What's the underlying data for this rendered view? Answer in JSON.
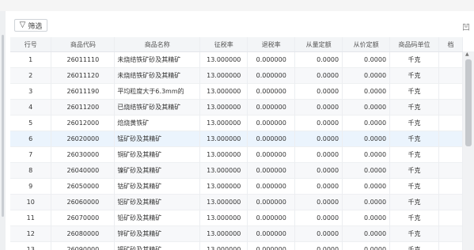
{
  "toolbar": {
    "filter_icon": "filter-icon",
    "filter_label": "筛选",
    "corner_label": "凹"
  },
  "table": {
    "columns": [
      "行号",
      "商品代码",
      "商品名称",
      "征税率",
      "退税率",
      "从量定额",
      "从价定额",
      "商品码单位",
      "档"
    ],
    "rows": [
      [
        "1",
        "26011110",
        "未烧结铁矿砂及其精矿",
        "13.000000",
        "0.000000",
        "0.0000",
        "0.0000",
        "千克"
      ],
      [
        "2",
        "26011120",
        "未烧结铁矿砂及其精矿",
        "13.000000",
        "0.000000",
        "0.0000",
        "0.0000",
        "千克"
      ],
      [
        "3",
        "26011190",
        "平均粒度大于6.3mm的",
        "13.000000",
        "0.000000",
        "0.0000",
        "0.0000",
        "千克"
      ],
      [
        "4",
        "26011200",
        "已烧结铁矿砂及其精矿",
        "13.000000",
        "0.000000",
        "0.0000",
        "0.0000",
        "千克"
      ],
      [
        "5",
        "26012000",
        "焙烧黄铁矿",
        "13.000000",
        "0.000000",
        "0.0000",
        "0.0000",
        "千克"
      ],
      [
        "6",
        "26020000",
        "锰矿砂及其精矿",
        "13.000000",
        "0.000000",
        "0.0000",
        "0.0000",
        "千克"
      ],
      [
        "7",
        "26030000",
        "铜矿砂及其精矿",
        "13.000000",
        "0.000000",
        "0.0000",
        "0.0000",
        "千克"
      ],
      [
        "8",
        "26040000",
        "镍矿砂及其精矿",
        "13.000000",
        "0.000000",
        "0.0000",
        "0.0000",
        "千克"
      ],
      [
        "9",
        "26050000",
        "钴矿砂及其精矿",
        "13.000000",
        "0.000000",
        "0.0000",
        "0.0000",
        "千克"
      ],
      [
        "10",
        "26060000",
        "铝矿砂及其精矿",
        "13.000000",
        "0.000000",
        "0.0000",
        "0.0000",
        "千克"
      ],
      [
        "11",
        "26070000",
        "铅矿砂及其精矿",
        "13.000000",
        "0.000000",
        "0.0000",
        "0.0000",
        "千克"
      ],
      [
        "12",
        "26080000",
        "锌矿砂及其精矿",
        "13.000000",
        "0.000000",
        "0.0000",
        "0.0000",
        "千克"
      ],
      [
        "13",
        "26090000",
        "锡矿砂及其精矿",
        "13.000000",
        "0.000000",
        "0.0000",
        "0.0000",
        "千克"
      ]
    ]
  },
  "colors": {
    "highlight_row": "#ebf4fd",
    "annotation_line": "#d42a2a"
  }
}
